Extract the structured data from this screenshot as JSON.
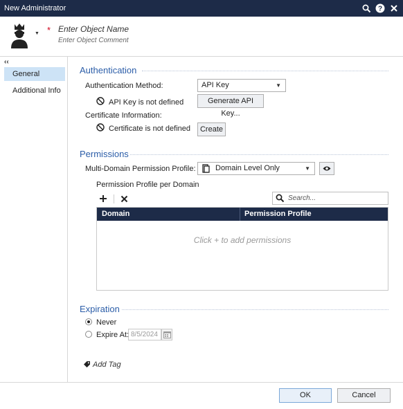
{
  "window": {
    "title": "New Administrator"
  },
  "header": {
    "object_name_placeholder": "Enter Object Name",
    "object_comment_placeholder": "Enter Object Comment"
  },
  "sidebar": {
    "collapse_label": "‹‹",
    "items": [
      {
        "label": "General",
        "active": true
      },
      {
        "label": "Additional Info",
        "active": false
      }
    ]
  },
  "authentication": {
    "title": "Authentication",
    "method_label": "Authentication Method:",
    "method_value": "API Key",
    "api_key_status": "API Key is not defined",
    "generate_button": "Generate API Key...",
    "cert_info_label": "Certificate Information:",
    "cert_status": "Certificate is not defined",
    "create_button": "Create"
  },
  "permissions": {
    "title": "Permissions",
    "profile_label": "Multi-Domain Permission Profile:",
    "profile_value": "Domain Level Only",
    "per_domain_label": "Permission Profile per Domain",
    "search_placeholder": "Search...",
    "columns": [
      "Domain",
      "Permission Profile"
    ],
    "empty_message": "Click + to add permissions"
  },
  "expiration": {
    "title": "Expiration",
    "never_label": "Never",
    "expire_label": "Expire At:",
    "expire_date": "8/5/2024",
    "selected": "never"
  },
  "tags": {
    "add_tag_label": "Add Tag"
  },
  "footer": {
    "ok": "OK",
    "cancel": "Cancel"
  },
  "colors": {
    "titlebar": "#1d2b48",
    "accent": "#2b5da8",
    "selection": "#cde3f6",
    "required": "#d0021b"
  }
}
